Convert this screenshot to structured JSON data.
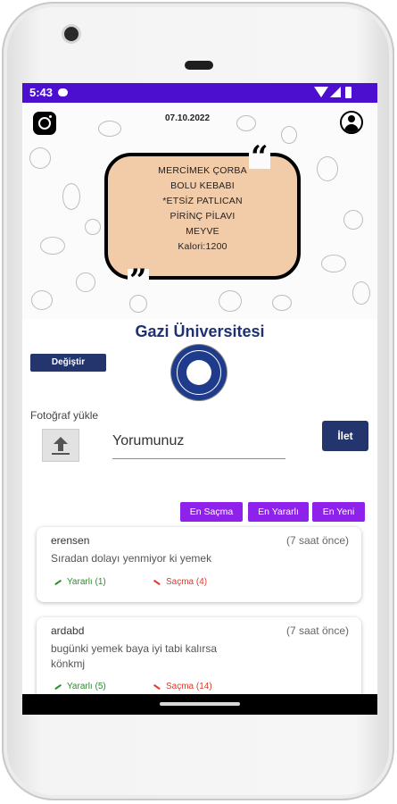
{
  "status_bar": {
    "time": "5:43"
  },
  "banner": {
    "date": "07.10.2022",
    "menu_items": [
      "MERCİMEK ÇORBA",
      "BOLU KEBABI",
      "*ETSİZ PATLICAN",
      "PİRİNÇ PİLAVI",
      "MEYVE",
      "Kalori:1200"
    ],
    "quote_open": "“",
    "quote_close": "”"
  },
  "university": {
    "name": "Gazi Üniversitesi",
    "change_label": "Değiştir"
  },
  "comment_form": {
    "photo_label": "Fotoğraf yükle",
    "placeholder": "Yorumunuz",
    "send_label": "İlet"
  },
  "sort_options": [
    "En Saçma",
    "En Yararlı",
    "En Yeni"
  ],
  "comments": [
    {
      "user": "erensen",
      "time": "(7 saat önce)",
      "text": "Sıradan dolayı yenmiyor ki yemek",
      "useful": "Yararlı (1)",
      "absurd": "Saçma (4)"
    },
    {
      "user": "ardabd",
      "time": "(7 saat önce)",
      "text": "bugünki yemek baya iyi tabi kalırsa könkmj",
      "useful": "Yararlı (5)",
      "absurd": "Saçma (14)"
    }
  ],
  "colors": {
    "status_bar": "#4c0fd0",
    "brand_navy": "#24356e",
    "sort_purple": "#8e21ea",
    "menu_box": "#f2cba9"
  }
}
